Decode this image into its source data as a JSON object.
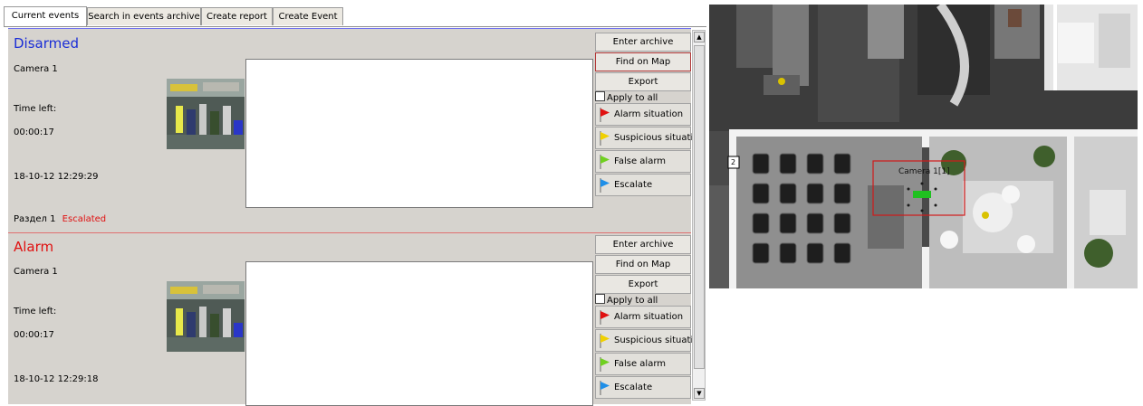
{
  "tabs": [
    "Current events",
    "Search in events archive",
    "Create report",
    "Create Event"
  ],
  "events": [
    {
      "status": "Disarmed",
      "status_color": "#1a2dd6",
      "camera": "Camera 1",
      "time_left_label": "Time left:",
      "time_left": "00:00:17",
      "timestamp": "18-10-12 12:29:29",
      "section": "Раздел 1",
      "section_status": "Escalated",
      "buttons": [
        "Enter archive",
        "Find on Map",
        "Export"
      ],
      "apply_to_all": "Apply to all",
      "actions": [
        {
          "label": "Alarm situation",
          "color": "#e01010"
        },
        {
          "label": "Suspicious situation",
          "color": "#f0d000"
        },
        {
          "label": "False alarm",
          "color": "#70d020"
        },
        {
          "label": "Escalate",
          "color": "#1f8fe8"
        }
      ]
    },
    {
      "status": "Alarm",
      "status_color": "#e01010",
      "camera": "Camera 1",
      "time_left_label": "Time left:",
      "time_left": "00:00:17",
      "timestamp": "18-10-12 12:29:18",
      "buttons": [
        "Enter archive",
        "Find on Map",
        "Export"
      ],
      "apply_to_all": "Apply to all",
      "actions": [
        {
          "label": "Alarm situation",
          "color": "#e01010"
        },
        {
          "label": "Suspicious situation",
          "color": "#f0d000"
        },
        {
          "label": "False alarm",
          "color": "#70d020"
        },
        {
          "label": "Escalate",
          "color": "#1f8fe8"
        }
      ]
    }
  ],
  "map": {
    "camera_label": "Camera 1[1]",
    "zone_marker": "2"
  }
}
